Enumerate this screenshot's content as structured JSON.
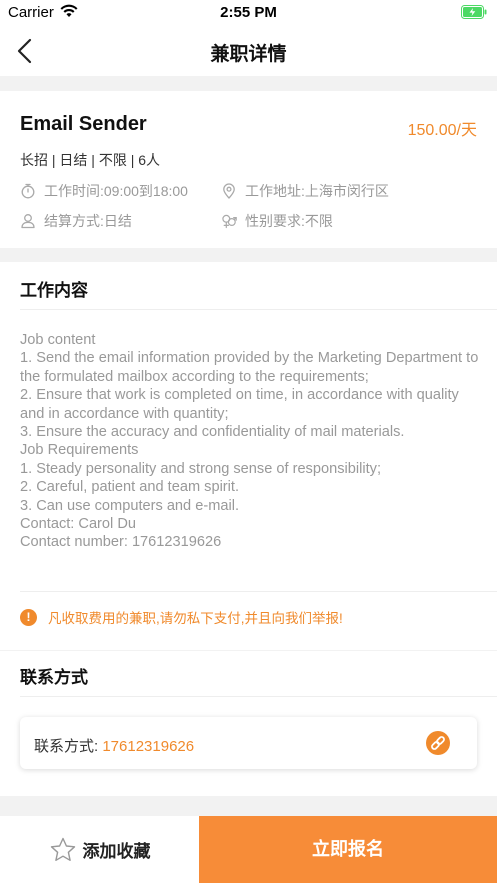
{
  "status_bar": {
    "carrier": "Carrier",
    "time": "2:55 PM"
  },
  "nav": {
    "title": "兼职详情"
  },
  "job": {
    "title": "Email Sender",
    "salary": "150.00/天",
    "tags": "长招 | 日结 | 不限 | 6人",
    "work_time": "工作时间:09:00到18:00",
    "work_address": "工作地址:上海市闵行区",
    "settlement": "结算方式:日结",
    "gender": "性别要求:不限"
  },
  "content": {
    "title": "工作内容",
    "description": "Job content\n1. Send the email information provided by the Marketing Department to the formulated mailbox according to the requirements;\n2. Ensure that work is completed on time, in accordance with quality and in accordance with quantity;\n3. Ensure the accuracy and confidentiality of mail materials.\nJob Requirements\n1. Steady personality and strong sense of responsibility;\n2. Careful, patient and team spirit.\n3. Can use computers and e-mail.\nContact: Carol Du\nContact number: 17612319626",
    "warning": "凡收取费用的兼职,请勿私下支付,并且向我们举报!"
  },
  "contact": {
    "title": "联系方式",
    "label": "联系方式: ",
    "value": "17612319626"
  },
  "bottom": {
    "favorite_label": "添加收藏",
    "apply_label": "立即报名"
  },
  "colors": {
    "accent": "#f08a2c",
    "apply_bg": "#f78c38",
    "battery": "#4cd964"
  }
}
